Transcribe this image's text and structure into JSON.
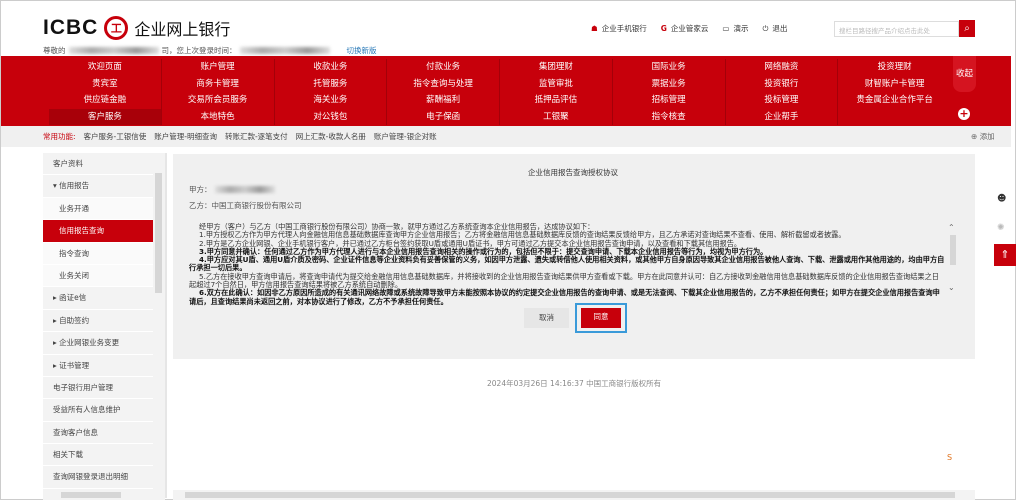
{
  "header": {
    "logo_text": "ICBC",
    "logo_seal": "工",
    "app_title": "企业网上银行",
    "greeting_prefix": "尊敬的",
    "greeting_suffix": "司，您上次登录时间：",
    "switch_version": "切换新版",
    "links": [
      {
        "icon": "mobile-bank-icon",
        "label": "企业手机银行"
      },
      {
        "icon": "cloud-icon",
        "label": "企业管家云"
      },
      {
        "icon": "demo-icon",
        "label": "演示"
      },
      {
        "icon": "power-icon",
        "label": "退出"
      }
    ],
    "search_placeholder": "搜栏目路径搜产品介绍点击此处"
  },
  "nav": {
    "items": [
      "欢迎页面",
      "账户管理",
      "收款业务",
      "付款业务",
      "集团理财",
      "国际业务",
      "网络融资",
      "投资理财",
      "贵宾室",
      "商务卡管理",
      "托管服务",
      "指令查询与处理",
      "监管审批",
      "票据业务",
      "投资银行",
      "财智账户卡管理",
      "供应链金融",
      "交易所会员服务",
      "海关业务",
      "薪酬福利",
      "抵押品评估",
      "招标管理",
      "投标管理",
      "贵金属企业合作平台",
      "客户服务",
      "本地特色",
      "对公钱包",
      "电子保函",
      "工银聚",
      "指令核查",
      "企业帮手",
      ""
    ],
    "collapse": "收起"
  },
  "quick": {
    "label": "常用功能:",
    "items": [
      "客户服务-工银信使",
      "账户管理-明细查询",
      "转账汇款-逐笔支付",
      "网上汇款-收款人名册",
      "账户管理-银企对账"
    ],
    "add": "添加"
  },
  "sidebar": {
    "items": [
      {
        "label": "客户资料",
        "type": "item"
      },
      {
        "label": "▾ 信用报告",
        "type": "item"
      },
      {
        "label": "业务开通",
        "type": "sub"
      },
      {
        "label": "信用报告查询",
        "type": "active"
      },
      {
        "label": "指令查询",
        "type": "sub"
      },
      {
        "label": "业务关闭",
        "type": "sub"
      },
      {
        "label": "▸ 函证e信",
        "type": "item"
      },
      {
        "label": "▸ 自助签约",
        "type": "item"
      },
      {
        "label": "▸ 企业网银业务变更",
        "type": "item"
      },
      {
        "label": "▸ 证书管理",
        "type": "item"
      },
      {
        "label": "电子银行用户管理",
        "type": "item"
      },
      {
        "label": "受益所有人信息维护",
        "type": "item"
      },
      {
        "label": "查询客户信息",
        "type": "item"
      },
      {
        "label": "相关下载",
        "type": "item"
      },
      {
        "label": "查询网银登录退出明细",
        "type": "item"
      }
    ]
  },
  "agreement": {
    "title": "企业信用报告查询授权协议",
    "party_a": "甲方：",
    "party_b": "乙方：中国工商银行股份有限公司",
    "paragraphs": [
      {
        "text": "经甲方（客户）与乙方（中国工商银行股份有限公司）协商一致，就甲方通过乙方系统查询本企业信用报告，达成协议如下：",
        "bold": false
      },
      {
        "text": "1.甲方授权乙方作为甲方代理人向金融信用信息基础数据库查询甲方企业信用报告；乙方将金融信用信息基础数据库反馈的查询结果反馈给甲方，且乙方承诺对查询结果不查看、使用、解析截留或者披露。",
        "bold": false
      },
      {
        "text": "2.甲方是乙方企业网银、企业手机银行客户，并已通过乙方柜台签约获取U盾或通用U盾证书，甲方可通过乙方提交本企业信用报告查询申请，以及查看和下载其信用报告。",
        "bold": false
      },
      {
        "text": "3.甲方同意并确认：任何通过乙方作为甲方代理人进行与本企业信用报告查询相关的操作或行为的，包括但不限于：提交查询申请、下载本企业信用报告等行为，均视为甲方行为。",
        "bold": true
      },
      {
        "text": "4.甲方应对其U盾、通用U盾介质及密码、企业证件信息等企业资料负有妥善保管的义务，如因甲方泄露、遗失或转借他人使用相关资料，或其他甲方自身原因导致其企业信用报告被他人查询、下载、泄露或用作其他用途的，均由甲方自行承担一切后果。",
        "bold": true
      },
      {
        "text": "5.乙方在接收甲方查询申请后，将查询申请代为提交给金融信用信息基础数据库，并将接收到的企业信用报告查询结果供甲方查看或下载。甲方在此同意并认可：自乙方接收到金融信用信息基础数据库反馈的企业信用报告查询结果之日起超过7个自然日，甲方信用报告查询结果将被乙方系统自动删除。",
        "bold": false
      },
      {
        "text": "6.双方在此确认：如因非乙方原因所造成的有关通讯网络故障或系统故障导致甲方未能按照本协议的约定提交企业信用报告的查询申请、或是无法查阅、下载其企业信用报告的，乙方不承担任何责任；如甲方在提交企业信用报告查询申请后，且查询结果尚未返回之前，对本协议进行了修改，乙方不予承担任何责任。",
        "bold": true
      }
    ],
    "cancel": "取消",
    "agree": "同意"
  },
  "footer": {
    "text": "2024年03月26日 14:16:37   中国工商银行版权所有"
  },
  "colors": {
    "brand": "#c7000b",
    "focus": "#3a9ad9"
  }
}
